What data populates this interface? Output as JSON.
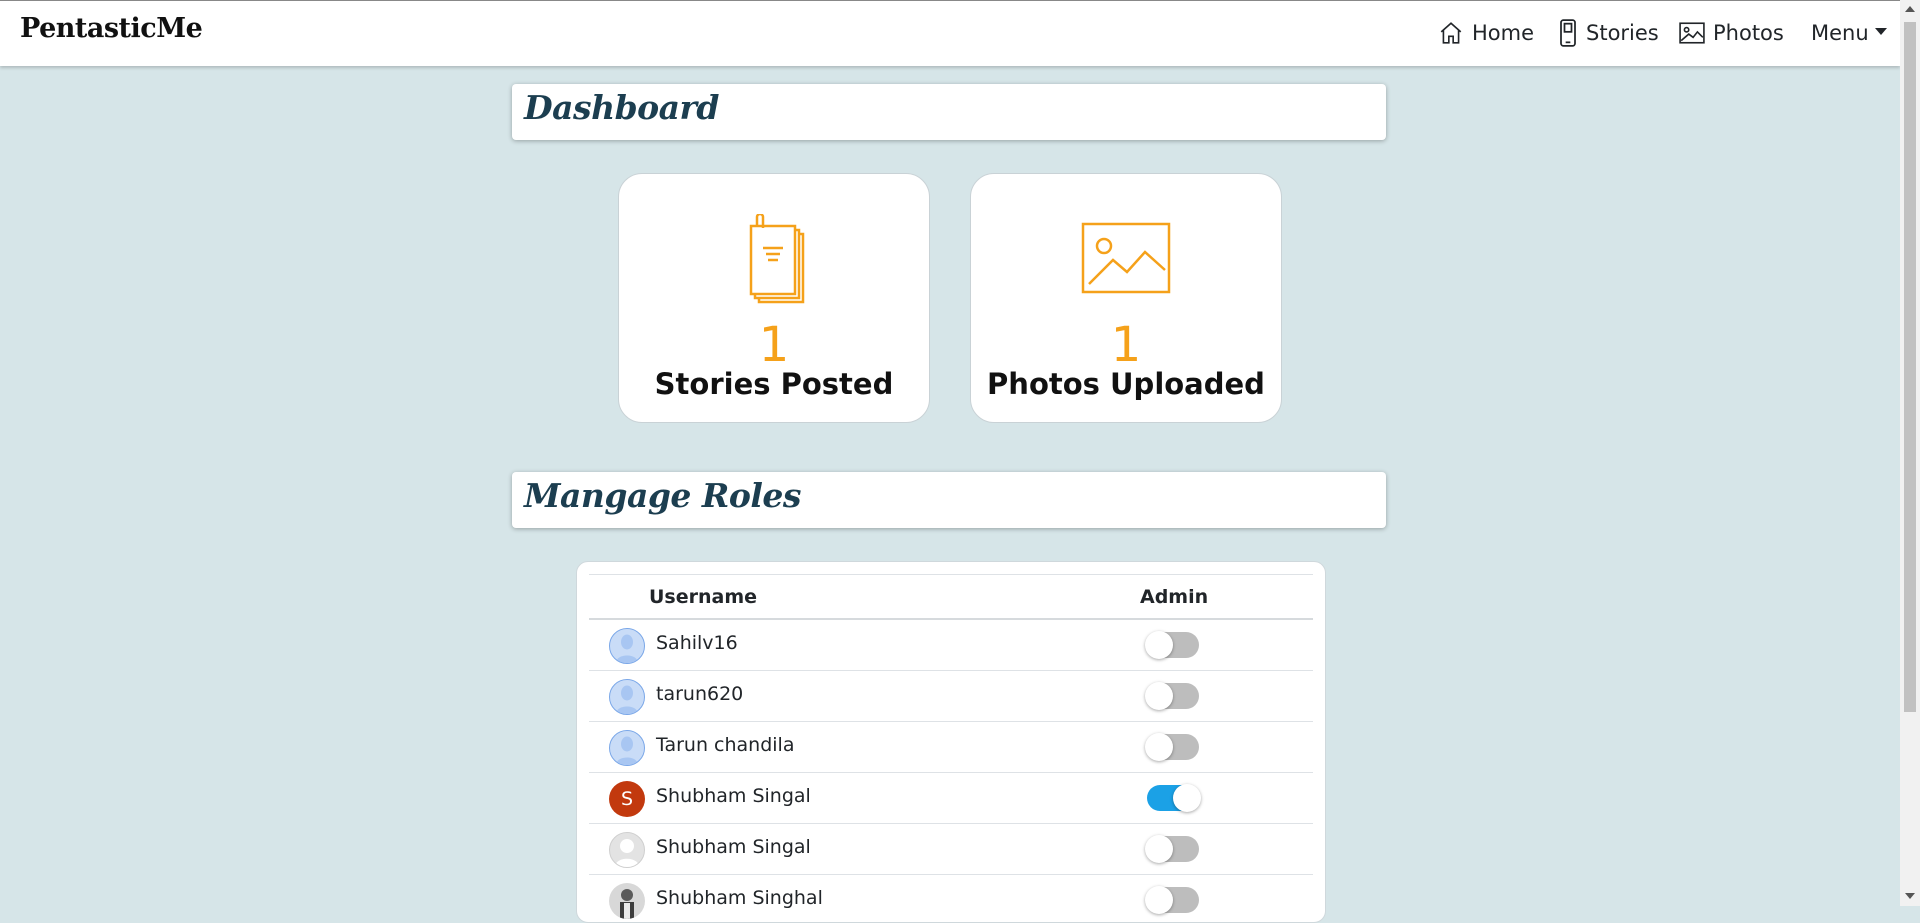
{
  "navbar": {
    "brand": "PentasticMe",
    "links": [
      {
        "label": "Home",
        "icon": "home-icon"
      },
      {
        "label": "Stories",
        "icon": "phone-icon"
      },
      {
        "label": "Photos",
        "icon": "image-icon"
      },
      {
        "label": "Menu",
        "icon": "caret-down-icon"
      }
    ]
  },
  "dashboard": {
    "title": "Dashboard",
    "stats": [
      {
        "value": "1",
        "label": "Stories Posted",
        "icon": "documents-icon"
      },
      {
        "value": "1",
        "label": "Photos Uploaded",
        "icon": "image-icon"
      }
    ],
    "accent_color": "#f5a11a"
  },
  "roles": {
    "title": "Mangage Roles",
    "columns": {
      "username": "Username",
      "admin": "Admin"
    },
    "users": [
      {
        "username": "Sahilv16",
        "admin": false,
        "avatar": "default-blue"
      },
      {
        "username": "tarun620",
        "admin": false,
        "avatar": "default-blue"
      },
      {
        "username": "Tarun chandila",
        "admin": false,
        "avatar": "default-blue"
      },
      {
        "username": "Shubham Singal",
        "admin": true,
        "avatar": "initial",
        "initial": "S"
      },
      {
        "username": "Shubham Singal",
        "admin": false,
        "avatar": "default-gray"
      },
      {
        "username": "Shubham Singhal",
        "admin": false,
        "avatar": "photo"
      }
    ]
  },
  "colors": {
    "background": "#d6e5e8",
    "header_text": "#1c3e50",
    "toggle_on": "#1ba1e6",
    "toggle_off": "#bdbdbd"
  }
}
